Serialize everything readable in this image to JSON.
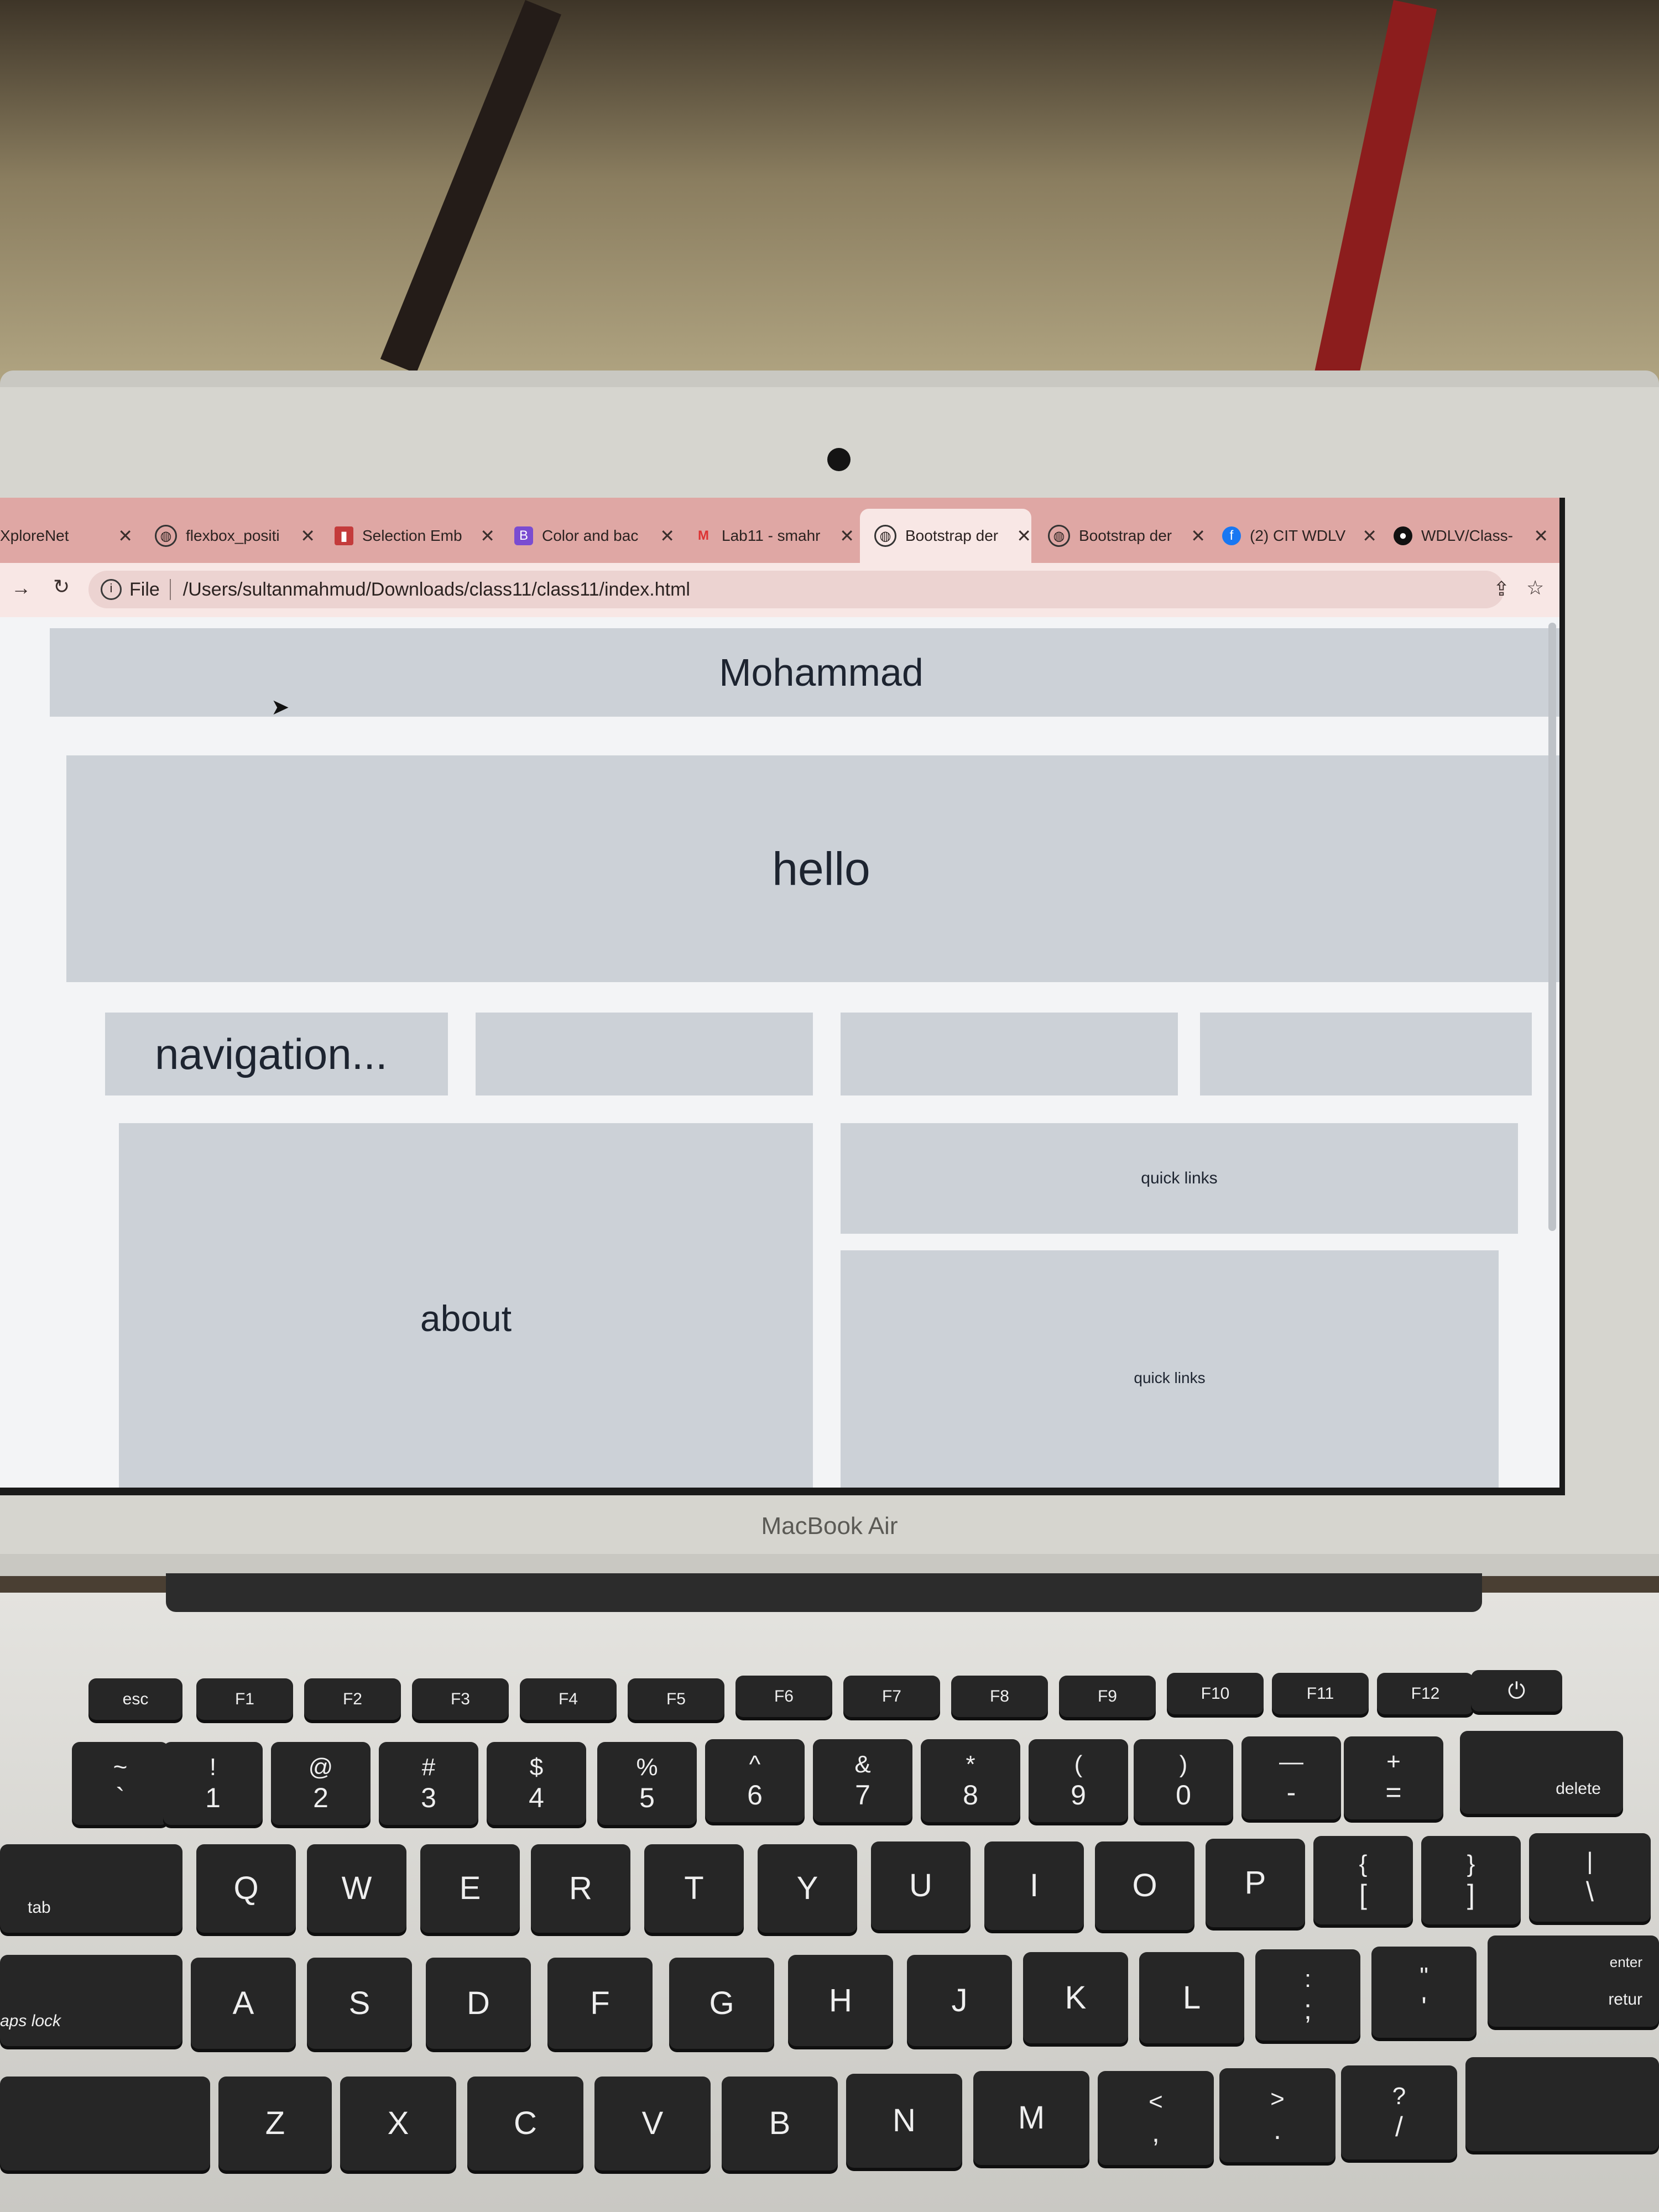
{
  "browser": {
    "tabs": [
      {
        "title": "XploreNet",
        "icon": "xplorenet-icon"
      },
      {
        "title": "flexbox_positi",
        "icon": "globe-icon"
      },
      {
        "title": "Selection Emb",
        "icon": "selection-icon"
      },
      {
        "title": "Color and bac",
        "icon": "bootstrap-icon"
      },
      {
        "title": "Lab11 - smahr",
        "icon": "gmail-icon"
      },
      {
        "title": "Bootstrap der",
        "icon": "globe-icon"
      },
      {
        "title": "Bootstrap der",
        "icon": "globe-icon"
      },
      {
        "title": "(2) CIT WDLV",
        "icon": "facebook-icon"
      },
      {
        "title": "WDLV/Class-",
        "icon": "github-icon"
      }
    ],
    "active_tab_index": 5,
    "new_tab_label": "+",
    "address": {
      "scheme_label": "File",
      "url": "/Users/sultanmahmud/Downloads/class11/class11/index.html"
    }
  },
  "page": {
    "header": "Mohammad",
    "hero": "hello",
    "navigation": "navigation...",
    "about": "about",
    "quick_links_1": "quick links",
    "quick_links_2": "quick links"
  },
  "laptop": {
    "brand": "MacBook Air"
  },
  "keyboard": {
    "fn_row": [
      "esc",
      "F1",
      "F2",
      "F3",
      "F4",
      "F5",
      "F6",
      "F7",
      "F8",
      "F9",
      "F10",
      "F11",
      "F12"
    ],
    "num_row": [
      {
        "top": "~",
        "bot": "`"
      },
      {
        "top": "!",
        "bot": "1"
      },
      {
        "top": "@",
        "bot": "2"
      },
      {
        "top": "#",
        "bot": "3"
      },
      {
        "top": "$",
        "bot": "4"
      },
      {
        "top": "%",
        "bot": "5"
      },
      {
        "top": "^",
        "bot": "6"
      },
      {
        "top": "&",
        "bot": "7"
      },
      {
        "top": "*",
        "bot": "8"
      },
      {
        "top": "(",
        "bot": "9"
      },
      {
        "top": ")",
        "bot": "0"
      },
      {
        "top": "—",
        "bot": "-"
      },
      {
        "top": "+",
        "bot": "="
      }
    ],
    "delete": "delete",
    "tab": "tab",
    "qwerty": [
      "Q",
      "W",
      "E",
      "R",
      "T",
      "Y",
      "U",
      "I",
      "O",
      "P"
    ],
    "qwerty_extra": [
      {
        "top": "{",
        "bot": "["
      },
      {
        "top": "}",
        "bot": "]"
      },
      {
        "top": "|",
        "bot": "\\"
      }
    ],
    "caps": "aps lock",
    "asdf": [
      "A",
      "S",
      "D",
      "F",
      "G",
      "H",
      "J",
      "K",
      "L"
    ],
    "asdf_extra": [
      {
        "top": ":",
        "bot": ";"
      },
      {
        "top": "\"",
        "bot": "'"
      }
    ],
    "enter_top": "enter",
    "enter_bot": "retur",
    "zxcv": [
      "Z",
      "X",
      "C",
      "V",
      "B",
      "N",
      "M"
    ],
    "zxcv_extra": [
      {
        "top": "<",
        "bot": ","
      },
      {
        "top": ">",
        "bot": "."
      },
      {
        "top": "?",
        "bot": "/"
      }
    ]
  }
}
